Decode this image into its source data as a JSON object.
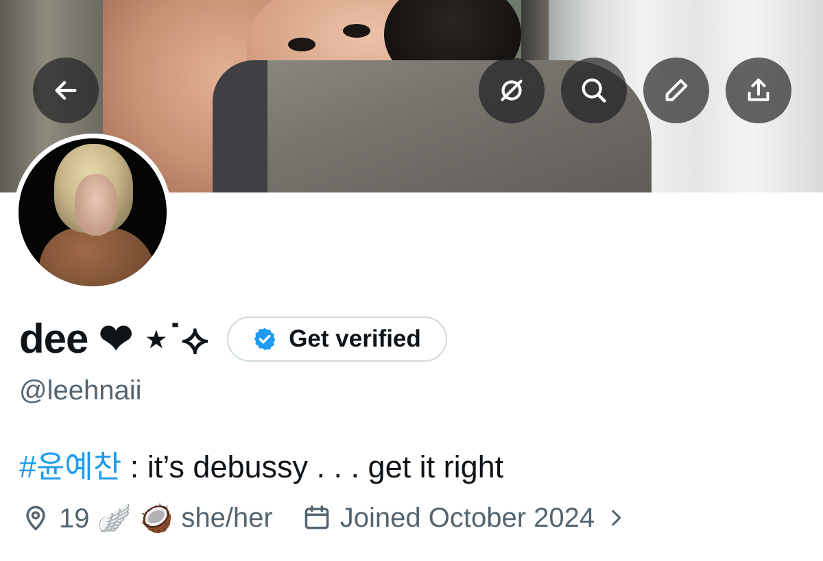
{
  "header": {
    "back_icon": "arrow-left-icon",
    "grok_icon": "grok-icon",
    "search_icon": "search-icon",
    "edit_icon": "pencil-icon",
    "share_icon": "share-icon"
  },
  "profile": {
    "display_name": "dee ❤ ⋆˙⟡",
    "verify_label": "Get verified",
    "handle": "@leehnaii",
    "bio_hashtag": "#윤예찬",
    "bio_text": " : it’s debussy . . . get it right",
    "location": "19 🪽 🥥",
    "pronouns": "she/her",
    "joined": "Joined October 2024"
  },
  "colors": {
    "accent": "#1d9bf0",
    "text_primary": "#0f1419",
    "text_secondary": "#536471",
    "border": "#cfd9de"
  }
}
